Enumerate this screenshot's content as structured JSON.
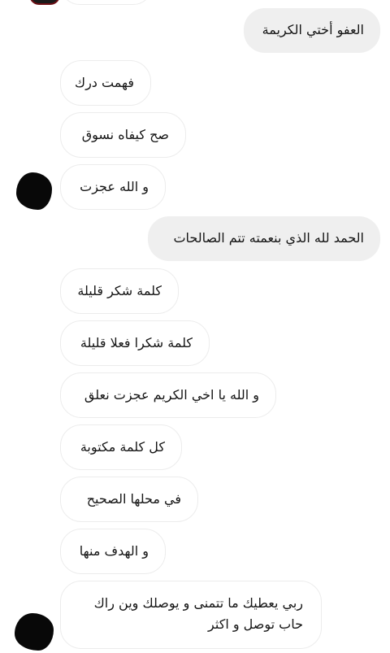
{
  "messages": [
    {
      "side": "out",
      "text": "العفو أختي الكريمة"
    },
    {
      "side": "in",
      "text": "فهمت درك"
    },
    {
      "side": "in",
      "text": "صح كيفاه نسوق"
    },
    {
      "side": "in",
      "text": "و الله عجزت"
    },
    {
      "side": "out",
      "text": "الحمد لله الذي بنعمته تتم الصالحات"
    },
    {
      "side": "in",
      "text": "كلمة شكر قليلة"
    },
    {
      "side": "in",
      "text": "كلمة شكرا فعلا قليلة"
    },
    {
      "side": "in",
      "text": "و الله يا اخي الكريم عجزت نعلق"
    },
    {
      "side": "in",
      "text": "كل كلمة مكتوبة"
    },
    {
      "side": "in",
      "text": "في محلها الصحيح"
    },
    {
      "side": "in",
      "text": "و الهدف منها"
    },
    {
      "side": "in",
      "text": "ربي يعطيك ما تتمنى و يوصلك وين راك حاب توصل و اكثر"
    }
  ],
  "colors": {
    "outgoing_bubble": "#efefef",
    "incoming_bubble_border": "#ececec",
    "text": "#151515",
    "avatar": "#080808"
  }
}
